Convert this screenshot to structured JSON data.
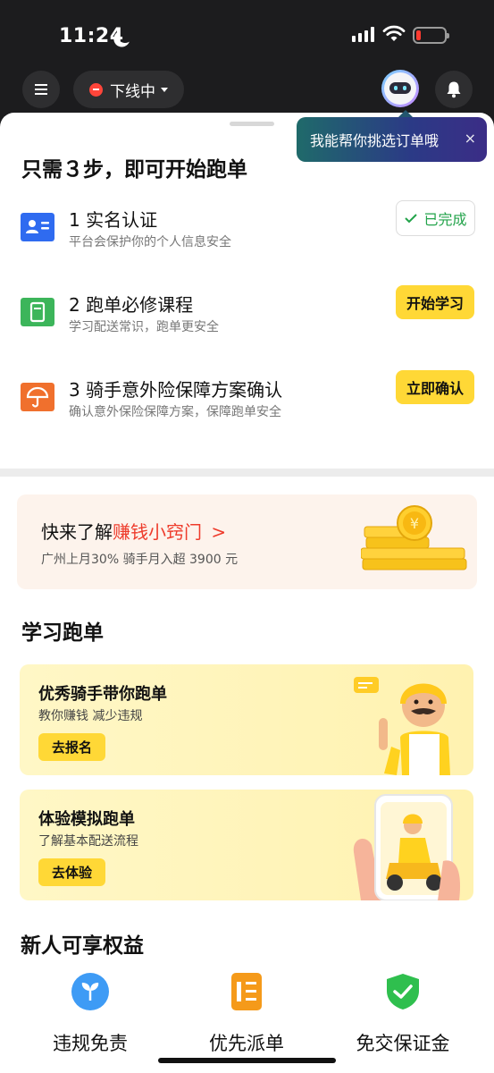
{
  "status_bar": {
    "time": "11:24"
  },
  "top_nav": {
    "state_label": "下线中"
  },
  "tooltip": {
    "text": "我能帮你挑选订单哦",
    "close": "×"
  },
  "steps_section": {
    "title": "只需３步，即可开始跑单",
    "steps": [
      {
        "title": "1 实名认证",
        "subtitle": "平台会保护你的个人信息安全",
        "action": "已完成",
        "action_state": "done",
        "icon": "id-card-icon",
        "icon_color": "#2f6bf0"
      },
      {
        "title": "2 跑单必修课程",
        "subtitle": "学习配送常识，跑单更安全",
        "action": "开始学习",
        "action_state": "todo",
        "icon": "course-book-icon",
        "icon_color": "#3cb55a"
      },
      {
        "title": "3 骑手意外险保障方案确认",
        "subtitle": "确认意外保险保障方案，保障跑单安全",
        "action": "立即确认",
        "action_state": "todo",
        "icon": "umbrella-icon",
        "icon_color": "#f0702d"
      }
    ]
  },
  "tips_banner": {
    "title_prefix": "快来了解",
    "title_highlight": "赚钱小窍门",
    "arrow": ">",
    "subtitle": "广州上月30% 骑手月入超 3900 元"
  },
  "learn_section": {
    "title": "学习跑单",
    "cards": [
      {
        "title": "优秀骑手带你跑单",
        "subtitle": "教你赚钱 减少违规",
        "button": "去报名"
      },
      {
        "title": "体验模拟跑单",
        "subtitle": "了解基本配送流程",
        "button": "去体验"
      }
    ]
  },
  "benefits_section": {
    "title": "新人可享权益",
    "items": [
      {
        "label": "违规免责",
        "icon": "sprout-icon",
        "color": "#3e9bf5"
      },
      {
        "label": "优先派单",
        "icon": "priority-list-icon",
        "color": "#f59a1a"
      },
      {
        "label": "免交保证金",
        "icon": "shield-check-icon",
        "color": "#2fbf4e"
      }
    ]
  },
  "colors": {
    "accent_yellow": "#ffd836",
    "done_green": "#22a34a",
    "highlight_red": "#ee3b2b"
  }
}
